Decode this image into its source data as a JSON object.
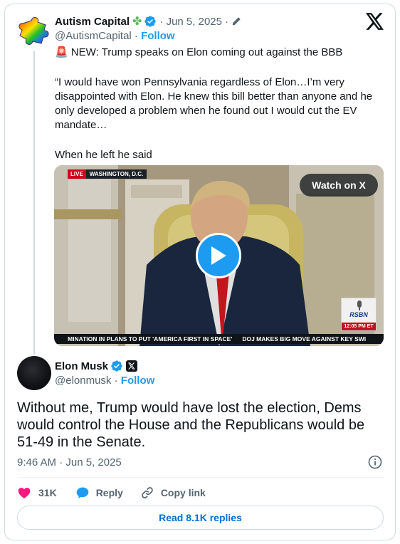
{
  "quoted_tweet": {
    "author_name": "Autism Capital",
    "clover_emoji": "✤",
    "date_meta": "· Jun 5, 2025 ·",
    "handle": "@AutismCapital",
    "separator": " · ",
    "follow_label": "Follow",
    "line1": "🚨 NEW: Trump speaks on Elon coming out against the BBB",
    "quote": "“I would have won Pennsylvania regardless of Elon…I’m very disappointed with Elon. He knew this bill better than anyone and he only developed a problem when he found out I would cut the EV mandate…",
    "line3": "When he left he said"
  },
  "video": {
    "live_label": "LIVE",
    "location_label": "WASHINGTON, D.C.",
    "watch_label": "Watch on X",
    "rsbn_logo": "RSBN",
    "rsbn_time": "12:05 PM ET",
    "ticker_1": "MINATION IN PLANS TO PUT 'AMERICA FIRST IN SPACE'",
    "ticker_2": "DOJ MAKES BIG MOVE AGAINST KEY SWI"
  },
  "main_tweet": {
    "author_name": "Elon Musk",
    "handle": "@elonmusk",
    "separator": " · ",
    "follow_label": "Follow",
    "text": "Without me, Trump would have lost the election, Dems would control the House and the Republicans would be 51-49 in the Senate.",
    "timestamp": "9:46 AM · Jun 5, 2025"
  },
  "actions": {
    "like_count": "31K",
    "reply_label": "Reply",
    "copy_link_label": "Copy link"
  },
  "read_replies_label": "Read 8.1K replies",
  "colors": {
    "accent_blue": "#1d9bf0",
    "like_pink": "#f91880",
    "link_blue": "#006fd6",
    "secondary_text": "#536471"
  },
  "icons": [
    "puzzle-avatar-icon",
    "clover-icon",
    "verified-badge-icon",
    "edit-pencil-icon",
    "x-logo-icon",
    "play-icon",
    "x-affiliate-badge-icon",
    "info-icon",
    "heart-icon",
    "reply-bubble-icon",
    "link-icon"
  ]
}
